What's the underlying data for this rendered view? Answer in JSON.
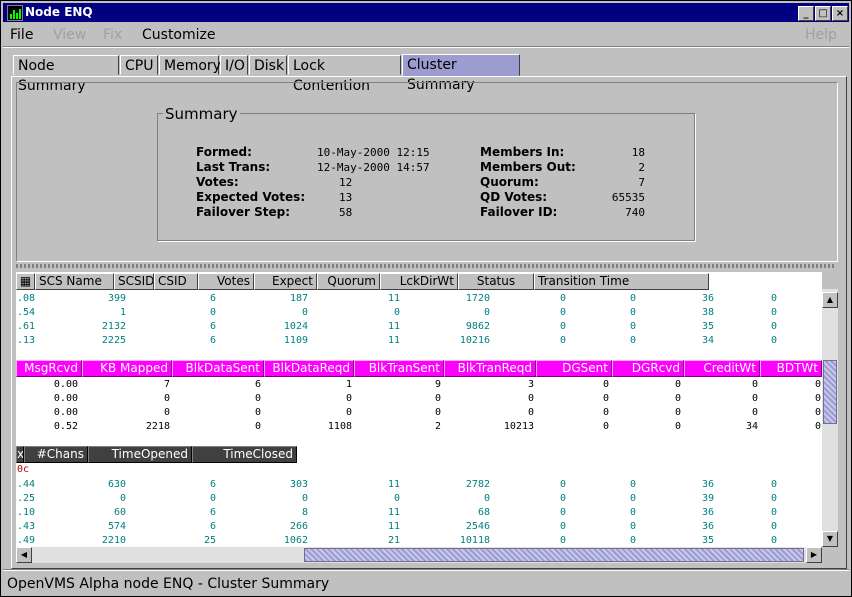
{
  "window": {
    "title": "Node ENQ",
    "controls": [
      "_",
      "□",
      "×"
    ]
  },
  "menu": {
    "items": [
      "File",
      "View",
      "Fix",
      "Customize"
    ],
    "help": "Help"
  },
  "tabs": [
    "Node Summary",
    "CPU",
    "Memory",
    "I/O",
    "Disk",
    "Lock Contention",
    "Cluster Summary"
  ],
  "active_tab": "Cluster Summary",
  "summary": {
    "title": "Summary",
    "left_labels": [
      "Formed:",
      "Last Trans:",
      "Votes:",
      "Expected Votes:",
      "Failover Step:"
    ],
    "left_values": [
      "10-May-2000 12:15",
      "12-May-2000 14:57",
      "12",
      "13",
      "58"
    ],
    "right_labels": [
      "Members In:",
      "Members Out:",
      "Quorum:",
      "QD Votes:",
      "Failover ID:"
    ],
    "right_values": [
      "18",
      "2",
      "7",
      "65535",
      "740"
    ]
  },
  "table1": {
    "headers": [
      "SCS Name",
      "SCSID",
      "CSID",
      "Votes",
      "Expect",
      "Quorum",
      "LckDirWt",
      "Status",
      "Transition Time"
    ],
    "rows": [
      [
        ".08",
        "399",
        "6",
        "187",
        "11",
        "1720",
        "0",
        "0",
        "36",
        "0"
      ],
      [
        ".54",
        "1",
        "0",
        "0",
        "0",
        "0",
        "0",
        "0",
        "38",
        "0"
      ],
      [
        ".61",
        "2132",
        "6",
        "1024",
        "11",
        "9862",
        "0",
        "0",
        "35",
        "0"
      ],
      [
        ".13",
        "2225",
        "6",
        "1109",
        "11",
        "10216",
        "0",
        "0",
        "34",
        "0"
      ]
    ]
  },
  "table2": {
    "headers": [
      "MsgRcvd",
      "KB Mapped",
      "BlkDataSent",
      "BlkDataReqd",
      "BlkTranSent",
      "BlkTranReqd",
      "DGSent",
      "DGRcvd",
      "CreditWt",
      "BDTWt"
    ],
    "rows": [
      [
        "0.00",
        "7",
        "6",
        "1",
        "9",
        "3",
        "0",
        "0",
        "0",
        "0"
      ],
      [
        "0.00",
        "0",
        "0",
        "0",
        "0",
        "0",
        "0",
        "0",
        "0",
        "0"
      ],
      [
        "0.00",
        "0",
        "0",
        "0",
        "0",
        "0",
        "0",
        "0",
        "0",
        "0"
      ],
      [
        "0.52",
        "2218",
        "0",
        "1108",
        "2",
        "10213",
        "0",
        "0",
        "34",
        "0"
      ]
    ]
  },
  "table3": {
    "headers": [
      "x",
      "#Chans",
      "TimeOpened",
      "TimeClosed"
    ],
    "first_row": "0c",
    "rows": [
      [
        ".44",
        "630",
        "6",
        "303",
        "11",
        "2782",
        "0",
        "0",
        "36",
        "0"
      ],
      [
        ".25",
        "0",
        "0",
        "0",
        "0",
        "0",
        "0",
        "0",
        "39",
        "0"
      ],
      [
        ".10",
        "60",
        "6",
        "8",
        "11",
        "68",
        "0",
        "0",
        "36",
        "0"
      ],
      [
        ".43",
        "574",
        "6",
        "266",
        "11",
        "2546",
        "0",
        "0",
        "36",
        "0"
      ],
      [
        ".49",
        "2210",
        "25",
        "1062",
        "21",
        "10118",
        "0",
        "0",
        "35",
        "0"
      ]
    ]
  },
  "status": "OpenVMS Alpha node ENQ - Cluster Summary",
  "colors": {
    "titlebar": "#000080",
    "active_tab": "#9c9cd0",
    "magenta_header": "#ff00ff",
    "dark_header": "#404040",
    "teal_text": "#008080"
  }
}
